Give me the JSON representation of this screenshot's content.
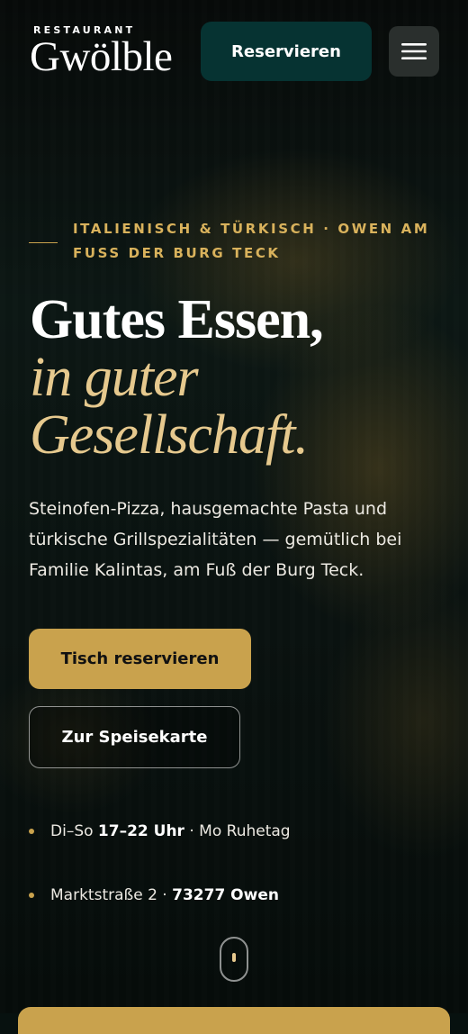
{
  "header": {
    "logo_eyebrow": "RESTAURANT",
    "logo_name": "Gwölble",
    "reserve_label": "Reservieren",
    "menu_icon": "hamburger-menu-icon"
  },
  "hero": {
    "eyebrow": "ITALIENISCH & TÜRKISCH · OWEN AM FUSS DER BURG TECK",
    "headline_line1": "Gutes Essen,",
    "headline_line2": "in guter",
    "headline_line3": "Gesellschaft.",
    "lead": "Steinofen-Pizza, hausgemachte Pasta und türkische Grillspezialitäten — gemütlich bei Familie Kalintas, am Fuß der Burg Teck.",
    "primary_cta": "Tisch reservieren",
    "secondary_cta": "Zur Speisekarte"
  },
  "info": {
    "hours_prefix": "Di–So",
    "hours_value": "17–22 Uhr",
    "hours_suffix": "· Mo Ruhetag",
    "address_street": "Marktstraße 2 ·",
    "address_city": "73277 Owen"
  },
  "colors": {
    "accent_gold": "#c9a24d",
    "headline_gold": "#e6c98e",
    "dark_teal": "#063332",
    "background": "#07110f"
  }
}
